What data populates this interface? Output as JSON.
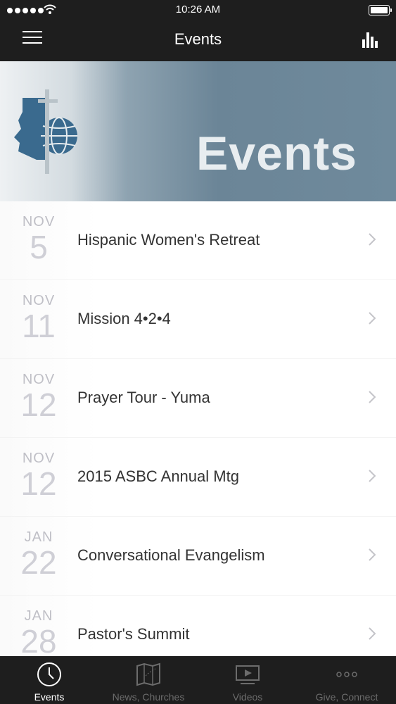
{
  "status_bar": {
    "time": "10:26 AM"
  },
  "nav": {
    "title": "Events"
  },
  "banner": {
    "text": "Events"
  },
  "events": [
    {
      "month": "NOV",
      "day": "5",
      "title": "Hispanic Women's Retreat"
    },
    {
      "month": "NOV",
      "day": "11",
      "title": "Mission 4•2•4"
    },
    {
      "month": "NOV",
      "day": "12",
      "title": "Prayer Tour - Yuma"
    },
    {
      "month": "NOV",
      "day": "12",
      "title": "2015 ASBC Annual Mtg"
    },
    {
      "month": "JAN",
      "day": "22",
      "title": "Conversational Evangelism"
    },
    {
      "month": "JAN",
      "day": "28",
      "title": "Pastor's Summit"
    }
  ],
  "tabs": [
    {
      "label": "Events",
      "icon": "clock-icon",
      "active": true
    },
    {
      "label": "News, Churches",
      "icon": "map-icon",
      "active": false
    },
    {
      "label": "Videos",
      "icon": "video-icon",
      "active": false
    },
    {
      "label": "Give, Connect",
      "icon": "more-icon",
      "active": false
    }
  ]
}
